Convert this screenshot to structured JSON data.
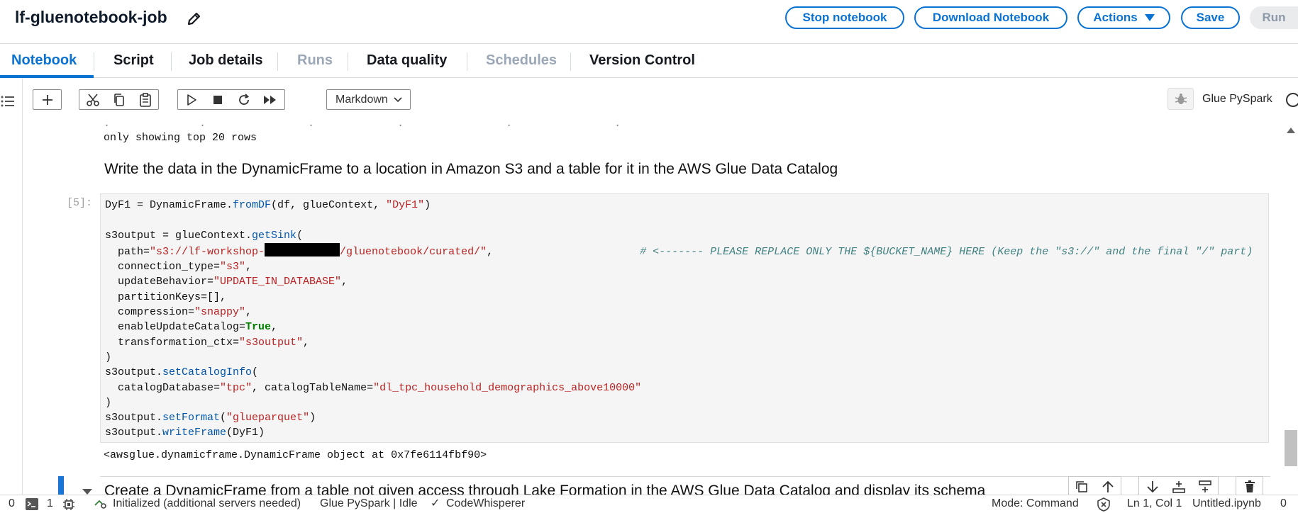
{
  "header": {
    "title": "lf-gluenotebook-job",
    "buttons": {
      "stop": "Stop notebook",
      "download": "Download Notebook",
      "actions": "Actions",
      "save": "Save",
      "run": "Run"
    }
  },
  "tabs": [
    "Notebook",
    "Script",
    "Job details",
    "Runs",
    "Data quality",
    "Schedules",
    "Version Control"
  ],
  "toolbar": {
    "cell_type": "Markdown",
    "kernel": "Glue PySpark"
  },
  "notebook": {
    "prev_output": "only showing top 20 rows",
    "heading": "Write the data in the DynamicFrame to a location in Amazon S3 and a table for it in the AWS Glue Data Catalog",
    "prompt": "[5]:",
    "code": {
      "l1_a": "DyF1 = DynamicFrame.",
      "l1_fn": "fromDF",
      "l1_b": "(df, glueContext, ",
      "l1_s": "\"DyF1\"",
      "l1_c": ")",
      "l3_a": "s3output = glueContext.",
      "l3_fn": "getSink",
      "l3_b": "(",
      "l4_a": "  path=",
      "l4_s1": "\"s3://lf-workshop-",
      "l4_s2": "/gluenotebook/curated/\"",
      "l4_b": ",",
      "l4_cm": "# <------- PLEASE REPLACE ONLY THE ${BUCKET_NAME} HERE (Keep the \"s3://\" and the final \"/\" part)",
      "l5_a": "  connection_type=",
      "l5_s": "\"s3\"",
      "l6_a": "  updateBehavior=",
      "l6_s": "\"UPDATE_IN_DATABASE\"",
      "l7_a": "  partitionKeys=",
      "l7_b": "[],",
      "l8_a": "  compression=",
      "l8_s": "\"snappy\"",
      "l9_a": "  enableUpdateCatalog=",
      "l9_kw": "True",
      "l10_a": "  transformation_ctx=",
      "l10_s": "\"s3output\"",
      "l11": ")",
      "l12_a": "s3output.",
      "l12_fn": "setCatalogInfo",
      "l12_b": "(",
      "l13_a": "  catalogDatabase=",
      "l13_s1": "\"tpc\"",
      "l13_b": ", catalogTableName=",
      "l13_s2": "\"dl_tpc_household_demographics_above10000\"",
      "l14": ")",
      "l15_a": "s3output.",
      "l15_fn": "setFormat",
      "l15_b": "(",
      "l15_s": "\"glueparquet\"",
      "l15_c": ")",
      "l16_a": "s3output.",
      "l16_fn": "writeFrame",
      "l16_b": "(DyF1)"
    },
    "output": "<awsglue.dynamicframe.DynamicFrame object at 0x7fe6114fbf90>",
    "next_heading": "Create a DynamicFrame from a table not given access through Lake Formation in the AWS Glue Data Catalog and display its schema"
  },
  "statusbar": {
    "count_a": "0",
    "count_b": "1",
    "init": "Initialized (additional servers needed)",
    "kernel_state": "Glue PySpark | Idle",
    "codewhisperer": "CodeWhisperer",
    "mode": "Mode: Command",
    "position": "Ln 1, Col 1",
    "file": "Untitled.ipynb",
    "count_c": "0"
  },
  "colors": {
    "accent": "#0972d3",
    "active_cell": "#1976d2"
  }
}
